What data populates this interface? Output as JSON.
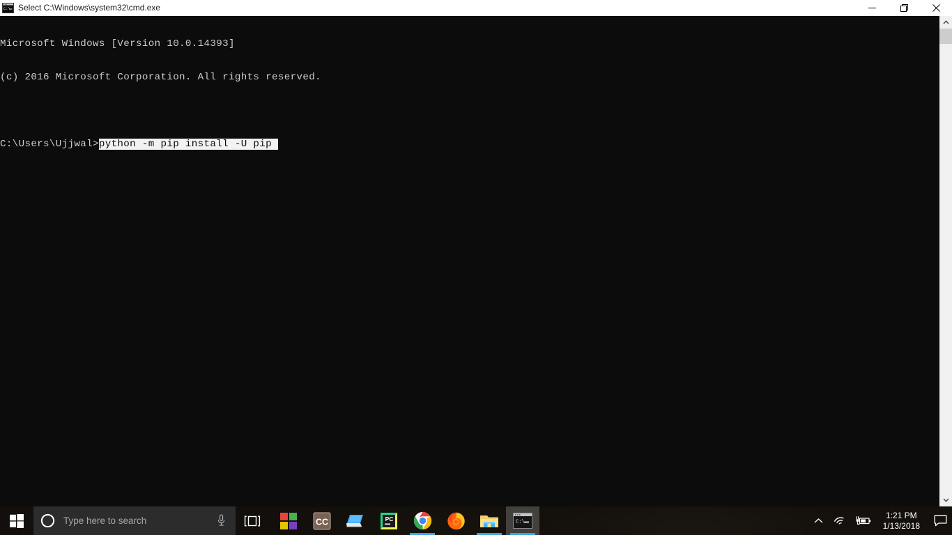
{
  "window": {
    "title": "Select C:\\Windows\\system32\\cmd.exe",
    "icon": "cmd-icon",
    "controls": {
      "minimize_label": "Minimize",
      "restore_label": "Restore",
      "close_label": "Close"
    }
  },
  "console": {
    "background_color": "#0c0c0c",
    "text_color": "#cccccc",
    "selection_bg_color": "#f2f2f2",
    "selection_fg_color": "#0c0c0c",
    "lines": [
      "Microsoft Windows [Version 10.0.14393]",
      "(c) 2016 Microsoft Corporation. All rights reserved.",
      "",
      ""
    ],
    "prompt": "C:\\Users\\Ujjwal>",
    "command": "python -m pip install -U pip ",
    "command_selected": true
  },
  "scrollbar": {
    "up_arrow": "chevron-up",
    "down_arrow": "chevron-down",
    "thumb_color": "#cdcdcd",
    "track_color": "#f0f0f0"
  },
  "taskbar": {
    "start_label": "Start",
    "search": {
      "placeholder": "Type here to search",
      "cortana_label": "Cortana",
      "mic_label": "Microphone"
    },
    "taskview_label": "Task View",
    "apps": [
      {
        "name": "microsoft-store",
        "label": "Microsoft Store",
        "running": false,
        "active": false
      },
      {
        "name": "creative-cloud",
        "label": "Creative Cloud",
        "running": false,
        "active": false
      },
      {
        "name": "remote-desktop",
        "label": "Remote Desktop",
        "running": false,
        "active": false
      },
      {
        "name": "pycharm",
        "label": "PyCharm",
        "running": false,
        "active": false
      },
      {
        "name": "google-chrome",
        "label": "Google Chrome",
        "running": true,
        "active": false
      },
      {
        "name": "mozilla-firefox",
        "label": "Mozilla Firefox",
        "running": false,
        "active": false
      },
      {
        "name": "file-explorer",
        "label": "File Explorer",
        "running": true,
        "active": false
      },
      {
        "name": "command-prompt",
        "label": "Command Prompt",
        "running": true,
        "active": true
      }
    ],
    "tray": {
      "show_hidden_label": "Show hidden icons",
      "network_label": "Network",
      "battery_label": "Battery charging",
      "time": "1:21 PM",
      "date": "1/13/2018",
      "action_center_label": "Action Center"
    }
  }
}
